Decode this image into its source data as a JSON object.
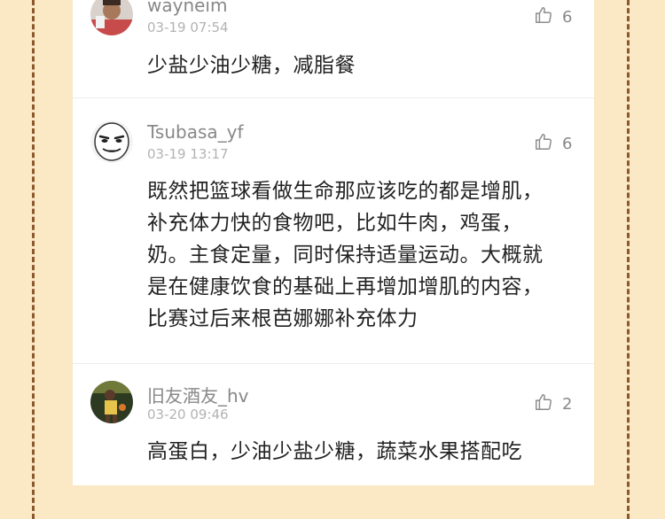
{
  "comments": [
    {
      "username": "wayneim",
      "time": "03-19 07:54",
      "likes": "6",
      "text_lines": [
        "少盐少油少糖，减脂餐"
      ]
    },
    {
      "username": "Tsubasa_yf",
      "time": "03-19 13:17",
      "likes": "6",
      "text_lines": [
        "既然把篮球看做生命那应该吃的都是增肌，",
        "补充体力快的食物吧，比如牛肉，鸡蛋，",
        "奶。主食定量，同时保持适量运动。大概就",
        "是在健康饮食的基础上再增加增肌的内容，",
        "比赛过后来根芭娜娜补充体力"
      ]
    },
    {
      "username": "旧友酒友_hv",
      "time": "03-20 09:46",
      "likes": "2",
      "text_lines": [
        "高蛋白，少油少盐少糖，蔬菜水果搭配吃"
      ]
    }
  ],
  "icons": {
    "like": "thumbs-up-icon"
  },
  "colors": {
    "background": "#fbe8c4",
    "border": "#8a5a2c",
    "card": "#ffffff"
  }
}
